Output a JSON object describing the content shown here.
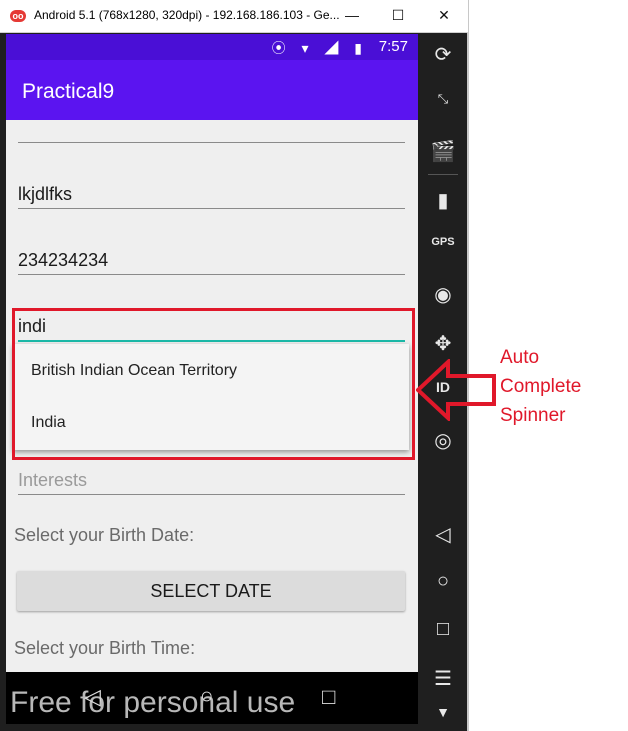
{
  "window": {
    "title": "Android 5.1 (768x1280, 320dpi) - 192.168.186.103 - Ge...",
    "minimize": "—",
    "maximize": "☐",
    "close": "✕"
  },
  "status_bar": {
    "icons": "⦿ ▾ ◢ ▮",
    "time": "7:57"
  },
  "app": {
    "title": "Practical9"
  },
  "form": {
    "field1_value": "lkjdlfks",
    "field2_value": "234234234",
    "country_input": "indi",
    "suggestions": [
      "British Indian Ocean Territory",
      "India"
    ],
    "interests_hint": "Interests",
    "birth_date_label": "Select your Birth Date:",
    "select_date_button": "SELECT DATE",
    "birth_time_label": "Select your Birth Time:"
  },
  "annotation": {
    "line1": "Auto",
    "line2": "Complete",
    "line3": "Spinner"
  },
  "watermark": "Free for personal use",
  "colors": {
    "status_bar": "#4a0fd6",
    "app_bar": "#5b14f0",
    "accent": "#1bb9a8",
    "annotation": "#e0182a"
  },
  "icons": {
    "toolbar": [
      "rotate-icon",
      "scale-icon",
      "screencast-icon",
      "battery-icon",
      "gps-icon",
      "camera-icon",
      "move-icon",
      "id-icon",
      "disk-icon",
      "back-icon",
      "home-icon",
      "recents-icon",
      "menu-icon",
      "more-icon"
    ]
  }
}
